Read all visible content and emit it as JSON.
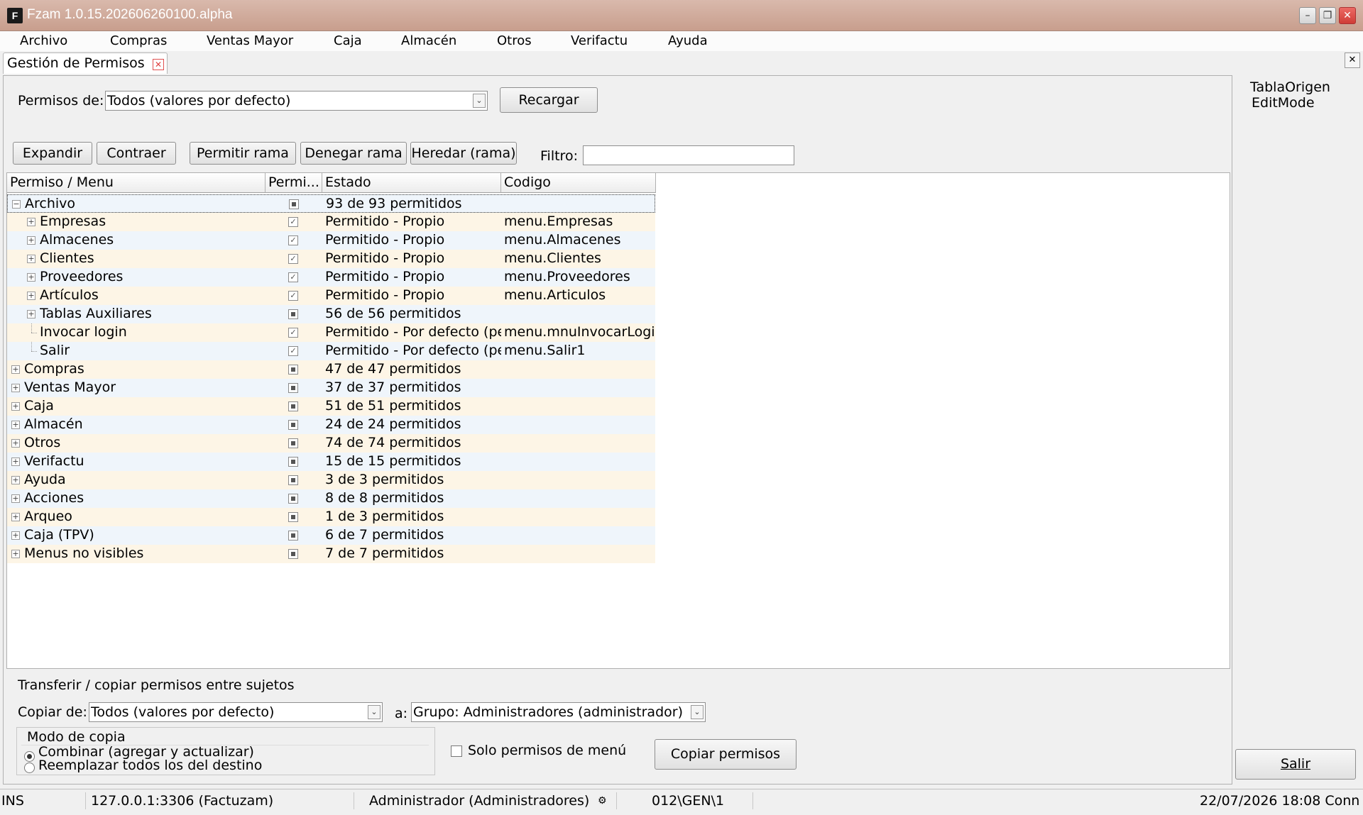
{
  "window": {
    "title": "Fzam 1.0.15.202606260100.alpha",
    "icon_label": "F",
    "buttons": [
      "minimize",
      "restore",
      "close"
    ]
  },
  "menubar": [
    {
      "label": "Archivo"
    },
    {
      "label": "Compras"
    },
    {
      "label": "Ventas Mayor"
    },
    {
      "label": "Caja"
    },
    {
      "label": "Almacén"
    },
    {
      "label": "Otros"
    },
    {
      "label": "Verifactu"
    },
    {
      "label": "Ayuda"
    }
  ],
  "tab": {
    "label": "Gestión de Permisos"
  },
  "toolbar": {
    "permisos_label": "Permisos de:",
    "permisos_value": "Todos (valores por defecto)",
    "recargar": "Recargar",
    "expandir": "Expandir",
    "contraer": "Contraer",
    "permitir_rama": "Permitir rama",
    "denegar_rama": "Denegar rama",
    "heredar_rama": "Heredar (rama)",
    "filtro_label": "Filtro:",
    "filtro_value": ""
  },
  "grid": {
    "columns": [
      "Permiso / Menu",
      "Permi...",
      "Estado",
      "Codigo"
    ],
    "rows": [
      {
        "name": "Archivo",
        "level": 0,
        "expander": "minus",
        "check": "indeterminate",
        "estado": "93 de 93 permitidos",
        "codigo": ""
      },
      {
        "name": "Empresas",
        "level": 1,
        "expander": "plus",
        "check": "checked",
        "estado": "Permitido - Propio",
        "codigo": "menu.Empresas"
      },
      {
        "name": "Almacenes",
        "level": 1,
        "expander": "plus",
        "check": "checked",
        "estado": "Permitido - Propio",
        "codigo": "menu.Almacenes"
      },
      {
        "name": "Clientes",
        "level": 1,
        "expander": "plus",
        "check": "checked",
        "estado": "Permitido - Propio",
        "codigo": "menu.Clientes"
      },
      {
        "name": "Proveedores",
        "level": 1,
        "expander": "plus",
        "check": "checked",
        "estado": "Permitido - Propio",
        "codigo": "menu.Proveedores"
      },
      {
        "name": "Artículos",
        "level": 1,
        "expander": "plus",
        "check": "checked",
        "estado": "Permitido - Propio",
        "codigo": "menu.Articulos"
      },
      {
        "name": "Tablas Auxiliares",
        "level": 1,
        "expander": "plus",
        "check": "indeterminate",
        "estado": "56 de 56 permitidos",
        "codigo": ""
      },
      {
        "name": "Invocar login",
        "level": 1,
        "expander": "none",
        "check": "checked",
        "estado": "Permitido - Por defecto (pe",
        "codigo": "menu.mnuInvocarLogir"
      },
      {
        "name": "Salir",
        "level": 1,
        "expander": "none",
        "check": "checked",
        "estado": "Permitido - Por defecto (pe",
        "codigo": "menu.Salir1"
      },
      {
        "name": "Compras",
        "level": 0,
        "expander": "plus",
        "check": "indeterminate",
        "estado": "47 de 47 permitidos",
        "codigo": ""
      },
      {
        "name": "Ventas Mayor",
        "level": 0,
        "expander": "plus",
        "check": "indeterminate",
        "estado": "37 de 37 permitidos",
        "codigo": ""
      },
      {
        "name": "Caja",
        "level": 0,
        "expander": "plus",
        "check": "indeterminate",
        "estado": "51 de 51 permitidos",
        "codigo": ""
      },
      {
        "name": "Almacén",
        "level": 0,
        "expander": "plus",
        "check": "indeterminate",
        "estado": "24 de 24 permitidos",
        "codigo": ""
      },
      {
        "name": "Otros",
        "level": 0,
        "expander": "plus",
        "check": "indeterminate",
        "estado": "74 de 74 permitidos",
        "codigo": ""
      },
      {
        "name": "Verifactu",
        "level": 0,
        "expander": "plus",
        "check": "indeterminate",
        "estado": "15 de 15 permitidos",
        "codigo": ""
      },
      {
        "name": "Ayuda",
        "level": 0,
        "expander": "plus",
        "check": "indeterminate",
        "estado": "3 de 3 permitidos",
        "codigo": ""
      },
      {
        "name": "Acciones",
        "level": 0,
        "expander": "plus",
        "check": "indeterminate",
        "estado": "8 de 8 permitidos",
        "codigo": ""
      },
      {
        "name": "Arqueo",
        "level": 0,
        "expander": "plus",
        "check": "indeterminate",
        "estado": "1 de 3 permitidos",
        "codigo": ""
      },
      {
        "name": "Caja (TPV)",
        "level": 0,
        "expander": "plus",
        "check": "indeterminate",
        "estado": "6 de 7 permitidos",
        "codigo": ""
      },
      {
        "name": "Menus no visibles",
        "level": 0,
        "expander": "plus",
        "check": "indeterminate",
        "estado": "7 de 7 permitidos",
        "codigo": ""
      }
    ]
  },
  "transfer": {
    "title": "Transferir / copiar permisos entre sujetos",
    "copiar_de_label": "Copiar de:",
    "copiar_de_value": "Todos (valores por defecto)",
    "a_label": "a:",
    "a_value": "Grupo: Administradores (administrador)",
    "modo_title": "Modo de copia",
    "modo_combinar": "Combinar (agregar y actualizar)",
    "modo_reemplazar": "Reemplazar todos los del destino",
    "solo_menu": "Solo permisos de menú",
    "copiar_btn": "Copiar permisos"
  },
  "side": {
    "line1": "TablaOrigen",
    "line2": "EditMode",
    "salir": "Salir"
  },
  "statusbar": {
    "mode": "INS",
    "server": "127.0.0.1:3306 (Factuzam)",
    "user": "Administrador (Administradores)",
    "code": "012\\GEN\\1",
    "datetime": "22/07/2026 18:08 Conn"
  }
}
